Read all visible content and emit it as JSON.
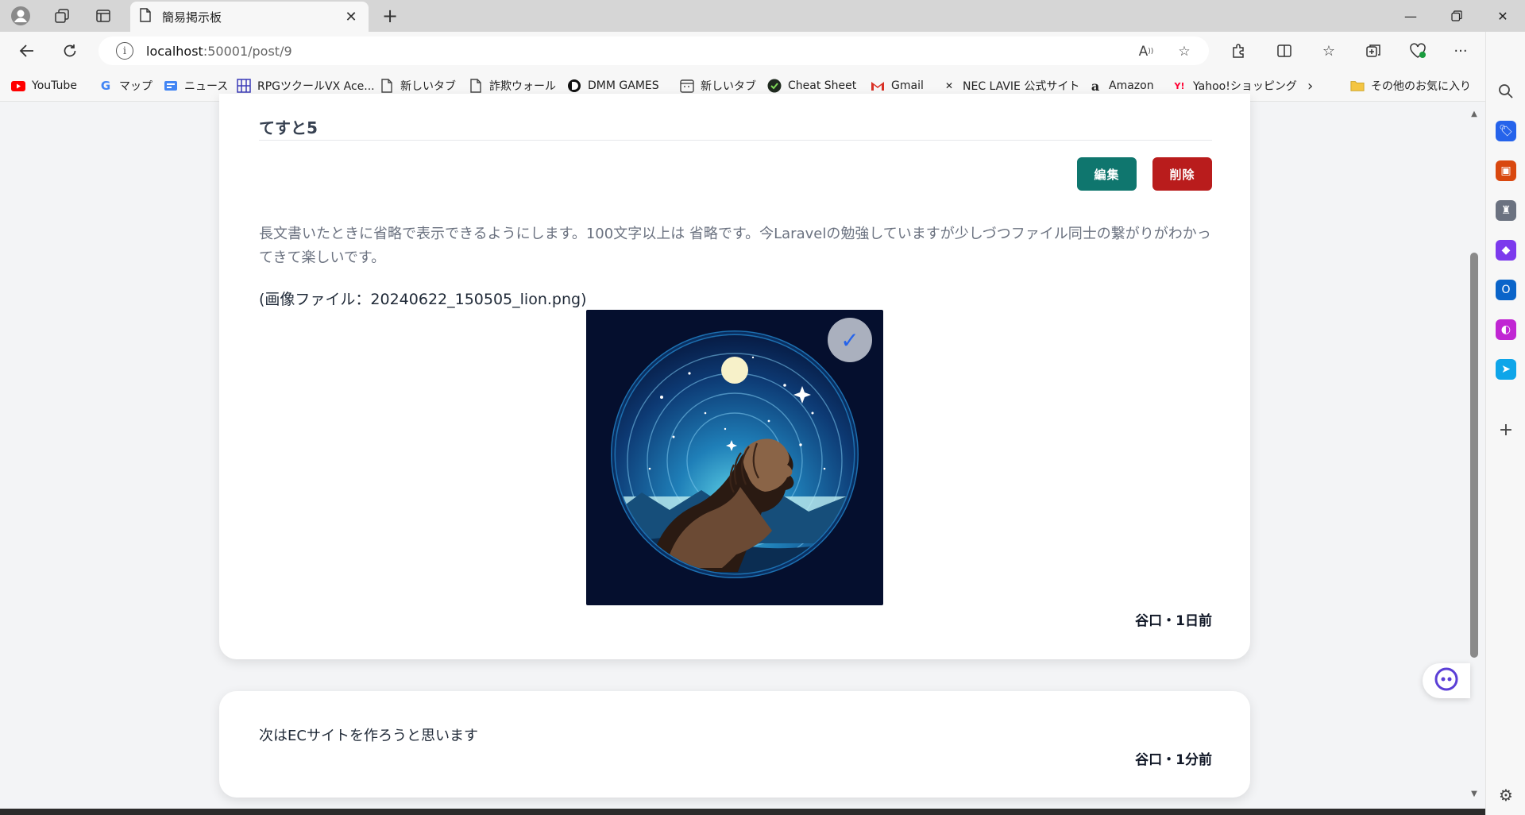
{
  "browser": {
    "tab_title": "簡易掲示板",
    "url_host": "localhost",
    "url_rest": ":50001/post/9"
  },
  "bookmarks": [
    {
      "label": "YouTube",
      "icon": "youtube-icon",
      "color": "#ff0000"
    },
    {
      "label": "マップ",
      "icon": "google-icon",
      "color": "#4285f4"
    },
    {
      "label": "ニュース",
      "icon": "news-icon",
      "color": "#4285f4"
    },
    {
      "label": "RPGツクールVX Ace...",
      "icon": "grid-icon",
      "color": "#3b3bb8"
    },
    {
      "label": "新しいタブ",
      "icon": "page-icon",
      "color": "#444444"
    },
    {
      "label": "詐欺ウォール",
      "icon": "page-icon",
      "color": "#444444"
    },
    {
      "label": "DMM GAMES",
      "icon": "dmm-icon",
      "color": "#111111"
    },
    {
      "label": "新しいタブ",
      "icon": "calendar-icon",
      "color": "#444444"
    },
    {
      "label": "Cheat Sheet",
      "icon": "cheat-sheet-icon",
      "color": "#1f5c1f"
    },
    {
      "label": "Gmail",
      "icon": "gmail-icon",
      "color": "#d93025"
    },
    {
      "label": "NEC LAVIE 公式サイト",
      "icon": "nec-icon",
      "color": "#111111"
    },
    {
      "label": "Amazon",
      "icon": "amazon-icon",
      "color": "#111111"
    },
    {
      "label": "Yahoo!ショッピング",
      "icon": "yahoo-icon",
      "color": "#ff0033"
    }
  ],
  "other_favorites": "その他のお気に入り",
  "post": {
    "title": "てすと5",
    "edit_label": "編集",
    "delete_label": "削除",
    "body": "長文書いたときに省略で表示できるようにします。100文字以上は 省略です。今Laravelの勉強していますが少しづつファイル同士の繋がりがわかってきて楽しいです。",
    "image_filename": "(画像ファイル：20240622_150505_lion.png)",
    "meta": "谷口・1日前"
  },
  "post2": {
    "body": "次はECサイトを作ろうと思います",
    "meta": "谷口・1分前"
  },
  "colors": {
    "edit_button": "#0f766e",
    "delete_button": "#b91c1c",
    "page_background": "#f3f4f6"
  }
}
